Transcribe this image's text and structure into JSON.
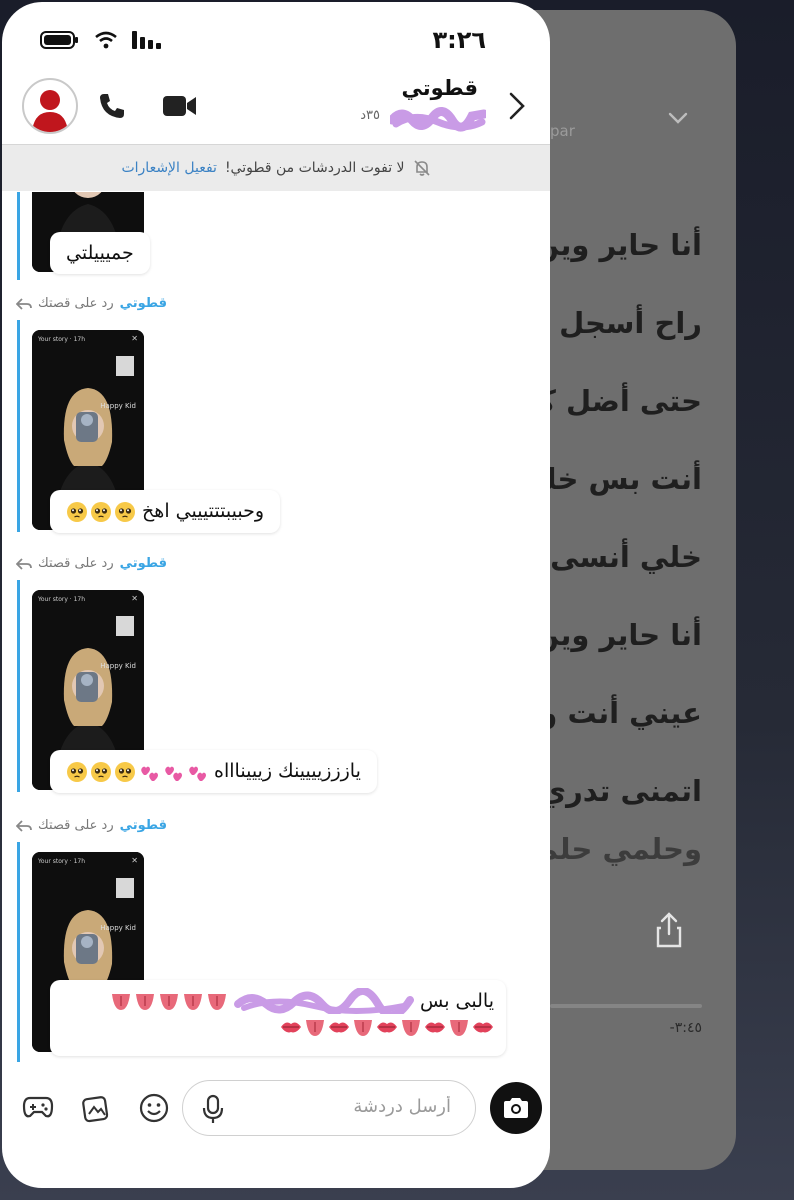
{
  "status_bar": {
    "time": "٣:٢٦"
  },
  "header": {
    "contact_name": "قطوتي",
    "last_seen": "٣٥د"
  },
  "notification_bar": {
    "text": "لا تفوت الدردشات من قطوتي!",
    "link": "تفعيل الإشعارات"
  },
  "messages": [
    {
      "reply_label": "",
      "reply_who": "",
      "text": "جميييلتي",
      "emoji_type": "",
      "emoji_count": 0
    },
    {
      "reply_label": "رد على قصتك",
      "reply_who": "قطوتي",
      "story_meta": "Your story · 17h",
      "story_caption": "Happy Kid",
      "text": "وحبيبتتتيييي اهخ",
      "emoji_type": "pleading",
      "emoji_count": 3
    },
    {
      "reply_label": "رد على قصتك",
      "reply_who": "قطوتي",
      "story_meta": "Your story · 17h",
      "story_caption": "Happy Kid",
      "text": "يازززيييينك زيييناااه",
      "emoji_type": "hearts+pleading",
      "emoji_count": 6
    },
    {
      "reply_label": "رد على قصتك",
      "reply_who": "قطوتي",
      "story_meta": "Your story · 17h",
      "story_caption": "Happy Kid",
      "text": "يالبى بس",
      "emoji_type": "tongue+lips",
      "emoji_count": 14
    }
  ],
  "composer": {
    "placeholder": "أرسل دردشة"
  },
  "background_app": {
    "top_text": "par",
    "lyrics": [
      "أنا حاير وين",
      "راح أسجل ر",
      "حتى أضل كل",
      "أنت بس خلي",
      "خلي أنسى و",
      "أنا حاير وين",
      "عيني أنت ور",
      "اتمنى تدري",
      "وحلمي حلم"
    ],
    "time_remaining": "-٣:٤٥"
  },
  "colors": {
    "accent_blue": "#3aa5e4",
    "redacted_purple": "#c99be6"
  }
}
